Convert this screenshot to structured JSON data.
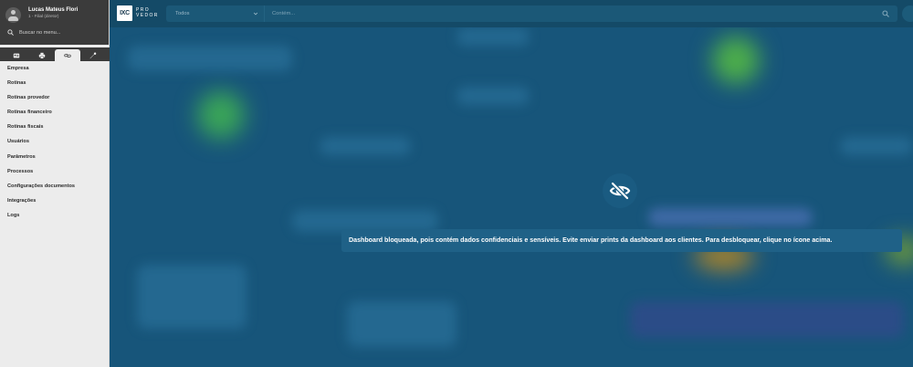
{
  "user": {
    "name": "Lucas Mateus Flori",
    "subtitle": "1 - Filial (diretor)"
  },
  "sidebar": {
    "search_placeholder": "Buscar no menu...",
    "tabs": [
      {
        "icon": "id-card-icon",
        "active": false
      },
      {
        "icon": "printer-icon",
        "active": false
      },
      {
        "icon": "link-icon",
        "active": true
      },
      {
        "icon": "wrench-icon",
        "active": false
      }
    ],
    "menu_items": [
      "Empresa",
      "Rotinas",
      "Rotinas provedor",
      "Rotinas financeiro",
      "Rotinas fiscais",
      "Usuários",
      "Parâmetros",
      "Processos",
      "Configurações documentos",
      "Integrações",
      "Logs"
    ]
  },
  "header": {
    "logo_mark": "IXC",
    "logo_text_line1": "PRO",
    "logo_text_line2": "VEDOR",
    "search_select_value": "Todos",
    "search_placeholder": "Contém..."
  },
  "dashboard": {
    "notice": "Dashboard bloqueada, pois contém dados confidenciais e sensíveis. Evite enviar prints da dashboard aos clientes. Para desbloquear, clique no ícone acima."
  },
  "colors": {
    "sidebar_bg": "#ececec",
    "user_panel_bg": "#3b3b3b",
    "header_bg": "#144a67",
    "dashboard_bg": "#17557a",
    "notice_bg": "#1f6187"
  }
}
